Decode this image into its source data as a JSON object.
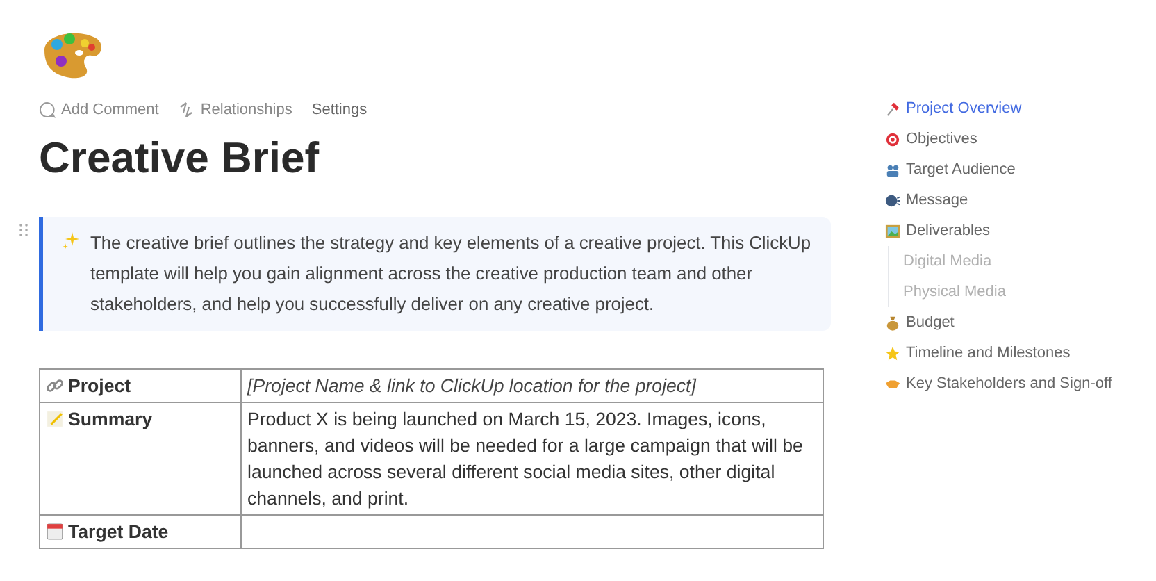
{
  "toolbar": [
    "Add Comment",
    "Relationships",
    "Settings"
  ],
  "title": "Creative Brief",
  "callout": "The creative brief outlines the strategy and key elements of a creative project. This ClickUp template will help you gain alignment across the creative production team and other stakeholders, and help you successfully deliver on any creative project.",
  "table": {
    "rows": [
      {
        "label": "Project",
        "value": "[Project Name & link to ClickUp location for the project]",
        "kind": "placeholder"
      },
      {
        "label": "Summary",
        "value": "Product X is being launched on March 15, 2023. Images, icons, banners, and videos will be needed for a large campaign that will be launched across several different social media sites, other digital channels, and print.",
        "kind": "text"
      },
      {
        "label": "Target Date",
        "kind": "empty"
      }
    ]
  },
  "outline": [
    {
      "label": "Project Overview",
      "selected": true
    },
    {
      "label": "Objectives",
      "selected": false
    },
    {
      "label": "Target Audience",
      "selected": false
    },
    {
      "label": "Message",
      "selected": false
    },
    {
      "label": "Deliverables",
      "selected": false,
      "children": [
        {
          "label": "Digital Media",
          "selected": false
        },
        {
          "label": "Physical Media",
          "selected": false
        }
      ]
    },
    {
      "label": "Budget",
      "selected": false
    },
    {
      "label": "Timeline and Milestones",
      "selected": false
    },
    {
      "label": "Key Stakeholders and Sign-off",
      "selected": false
    }
  ]
}
